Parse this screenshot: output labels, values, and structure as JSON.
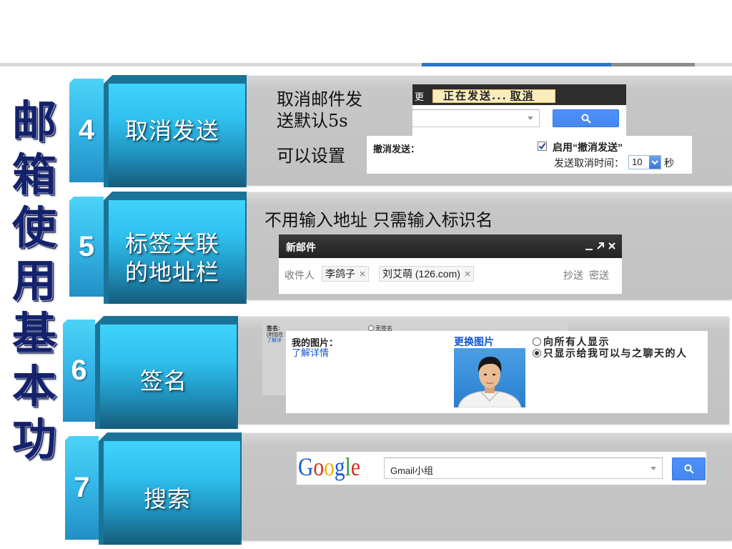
{
  "slide": {
    "title": "邮箱使用基本功",
    "colors": {
      "title": "#14226b",
      "accent": "#2a74c8",
      "label_top": "#3fd3fb",
      "label_bottom": "#155b79",
      "num_top": "#4dd2f7",
      "num_bottom": "#238fc4",
      "gmail_blue": "#4d90fe",
      "link": "#1155cc"
    }
  },
  "rows": {
    "cancel_send": {
      "number": "4",
      "label_lines": [
        "取消发送"
      ],
      "desc_lines": [
        "取消邮件发",
        "送默认5s"
      ],
      "desc_note": "可以设置",
      "sending_bar": {
        "more_fragment": "更",
        "status": "正在发送...",
        "cancel_link": "取消"
      },
      "undo_settings": {
        "heading": "撤消发送：",
        "enable_label": "启用“撤消发送”",
        "enabled": true,
        "delay_label": "发送取消时间：",
        "delay_value": "10",
        "unit": "秒"
      }
    },
    "address_tags": {
      "number": "5",
      "label_lines": [
        "标签关联",
        "的地址栏"
      ],
      "desc": "不用输入地址 只需输入标识名",
      "compose": {
        "title": "新邮件",
        "to_label": "收件人",
        "recipients": [
          "李鸽子",
          "刘艾萌 (126.com)"
        ],
        "cc": "抄送",
        "bcc": "密送",
        "icons": [
          "minimize-icon",
          "popout-icon",
          "close-icon"
        ]
      }
    },
    "signature": {
      "number": "6",
      "label_lines": [
        "签名"
      ],
      "bg_settings": {
        "label": "签名:",
        "note": "(附加在",
        "learn": "了解详",
        "no_signature": "无签名"
      },
      "picture": {
        "heading": "我的图片：",
        "learn_more": "了解详情",
        "change": "更换图片",
        "options": [
          {
            "label": "向所有人显示",
            "selected": false
          },
          {
            "label": "只显示给我可以与之聊天的人",
            "selected": true
          }
        ]
      }
    },
    "search": {
      "number": "7",
      "label_lines": [
        "搜索"
      ],
      "logo": "Google",
      "logo_colors": [
        "#1a5bd6",
        "#d62d20",
        "#f0b400",
        "#1a5bd6",
        "#2b9c3b",
        "#d62d20"
      ],
      "query": "Gmail小组"
    }
  }
}
